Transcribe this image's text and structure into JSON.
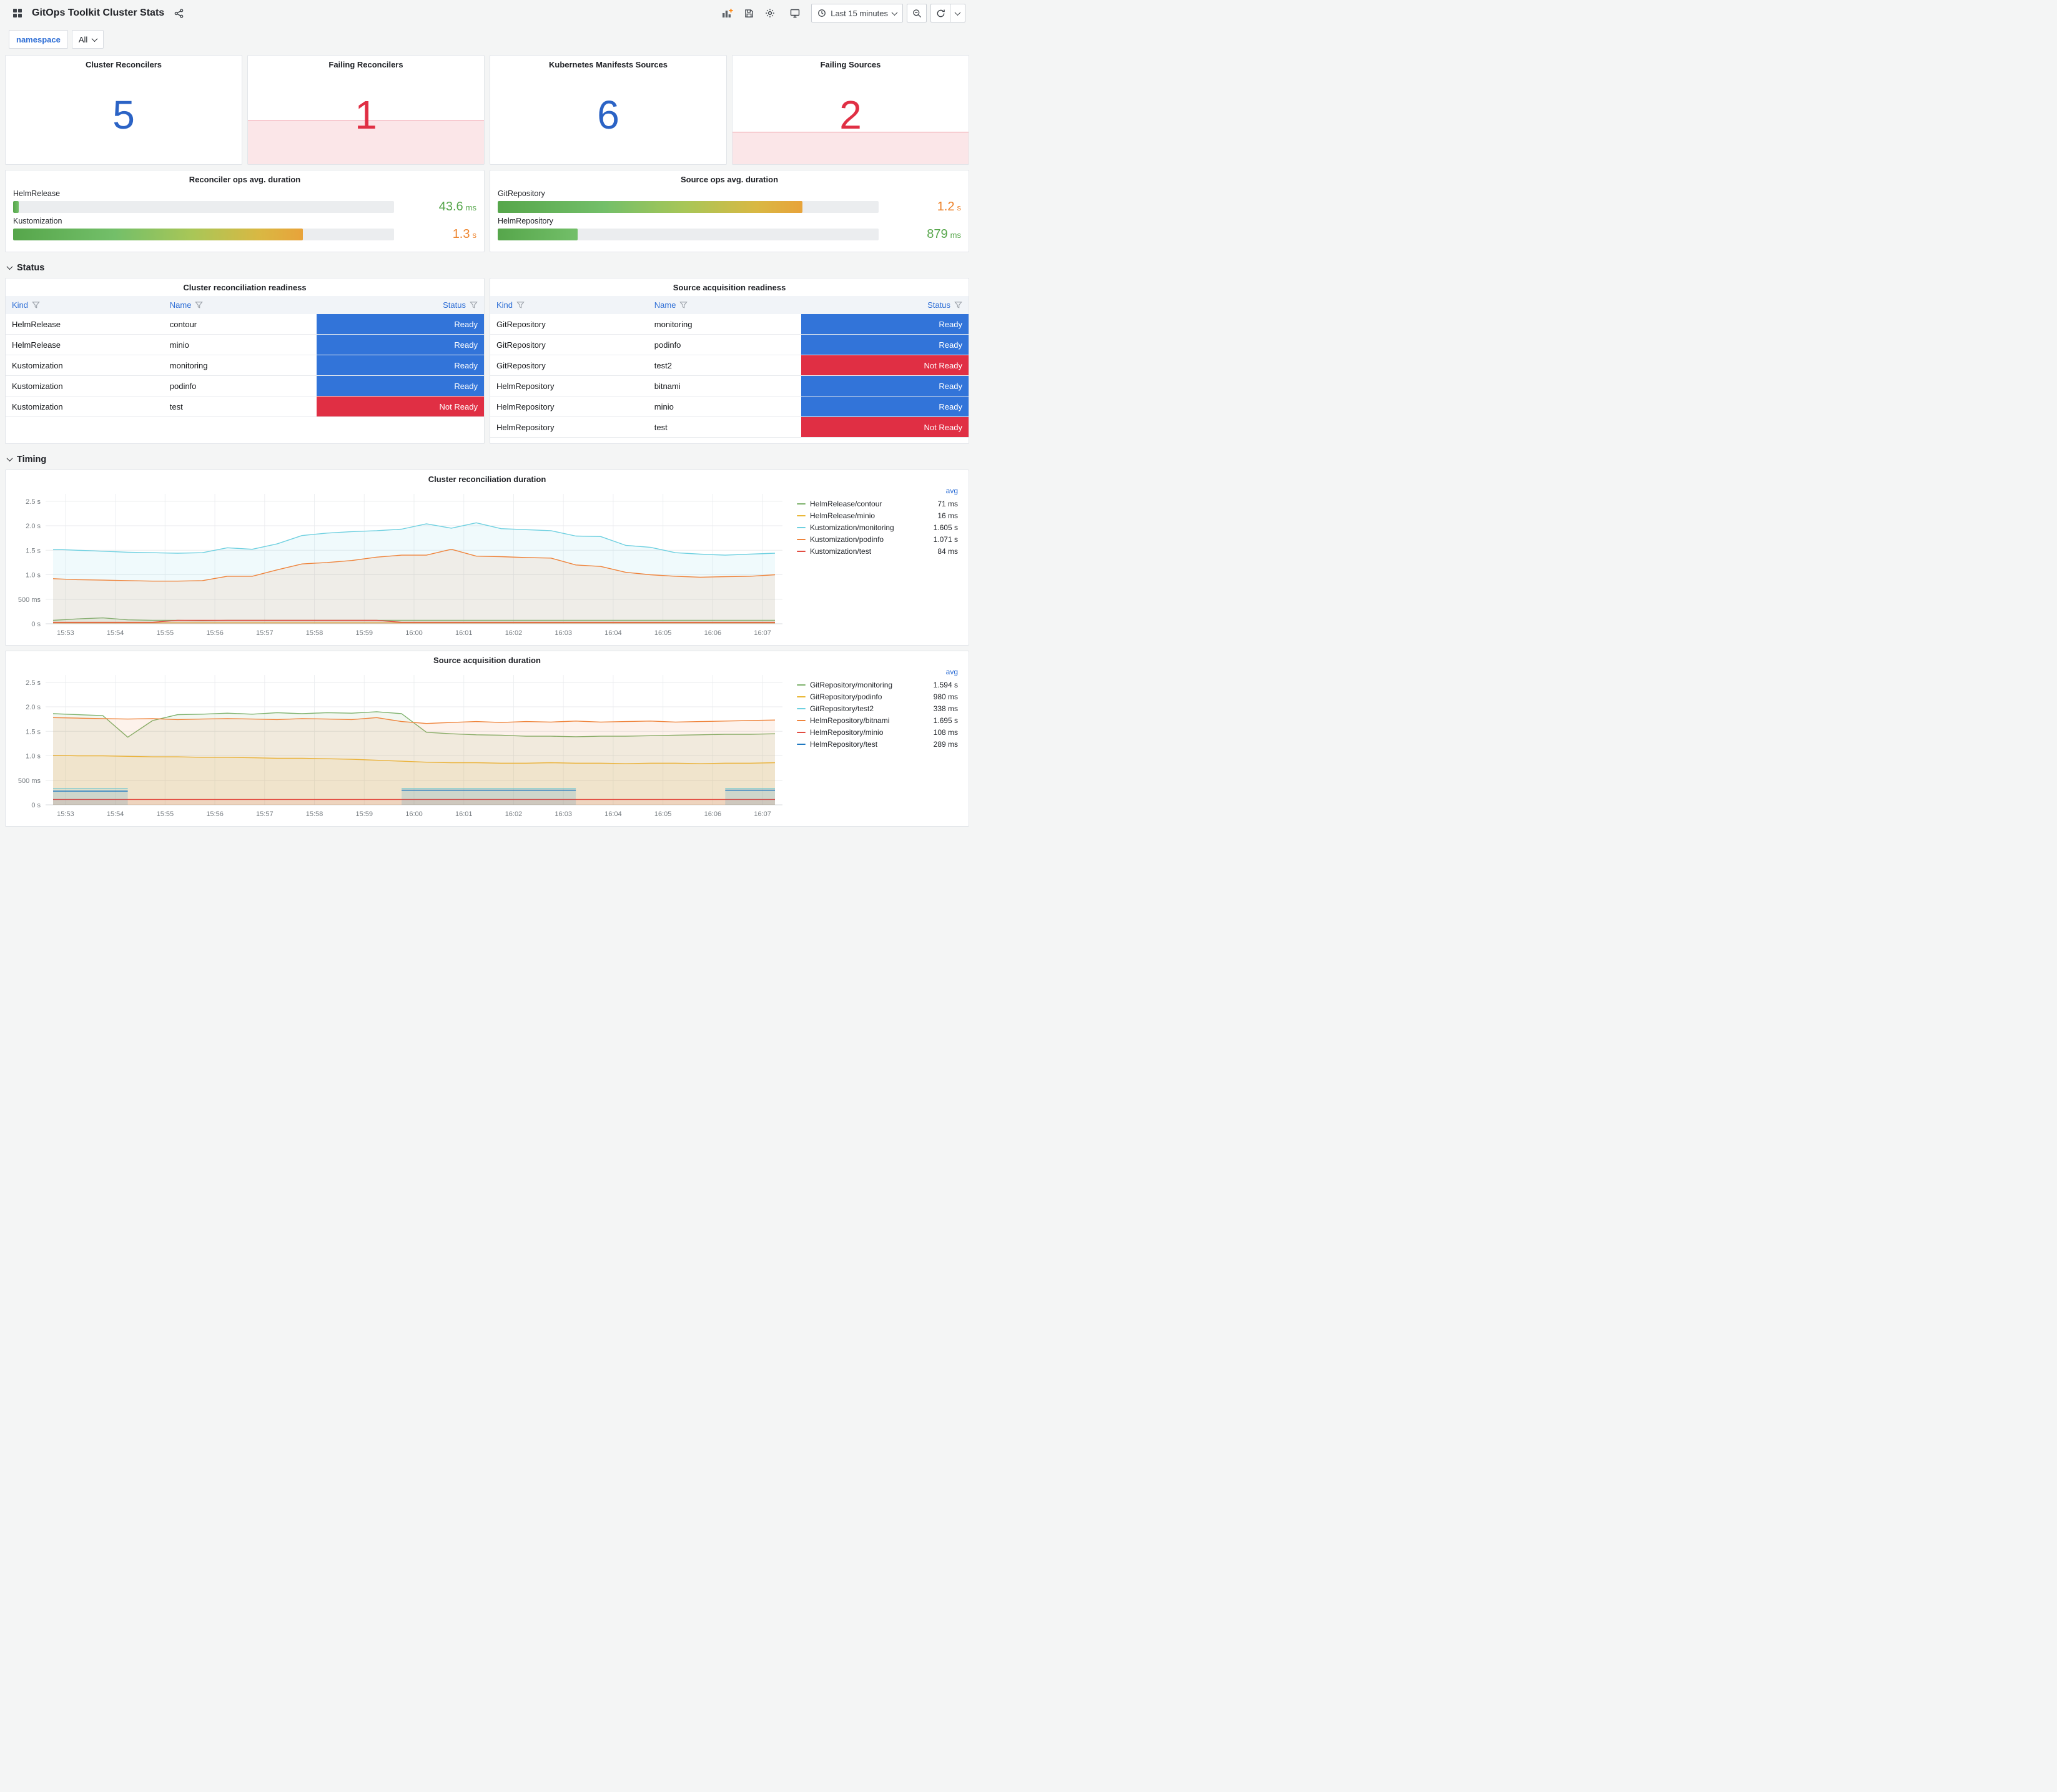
{
  "header": {
    "title": "GitOps Toolkit Cluster Stats",
    "time_range": "Last 15 minutes"
  },
  "filters": {
    "namespace_label": "namespace",
    "namespace_value": "All"
  },
  "colors": {
    "ok": "#2b63c5",
    "alert": "#e02f44",
    "ready": "#3274d9",
    "not_ready": "#e02f44",
    "green": "#56a64b",
    "orange": "#ed8128",
    "link_blue": "#2f6fd6"
  },
  "stats": [
    {
      "title": "Cluster Reconcilers",
      "value": "5",
      "state": "ok",
      "band_pct": 0
    },
    {
      "title": "Failing Reconcilers",
      "value": "1",
      "state": "alert",
      "band_pct": 40
    },
    {
      "title": "Kubernetes Manifests Sources",
      "value": "6",
      "state": "ok",
      "band_pct": 0
    },
    {
      "title": "Failing Sources",
      "value": "2",
      "state": "alert",
      "band_pct": 30
    }
  ],
  "gauge_panels": [
    {
      "title": "Reconciler ops avg. duration",
      "rows": [
        {
          "label": "HelmRelease",
          "value": "43.6",
          "unit": "ms",
          "pct": 1.5,
          "value_color": "#56a64b",
          "bar": "green"
        },
        {
          "label": "Kustomization",
          "value": "1.3",
          "unit": "s",
          "pct": 76,
          "value_color": "#ed8128",
          "bar": "mix"
        }
      ]
    },
    {
      "title": "Source ops avg. duration",
      "rows": [
        {
          "label": "GitRepository",
          "value": "1.2",
          "unit": "s",
          "pct": 80,
          "value_color": "#ed8128",
          "bar": "mix"
        },
        {
          "label": "HelmRepository",
          "value": "879",
          "unit": "ms",
          "pct": 21,
          "value_color": "#56a64b",
          "bar": "green"
        }
      ]
    }
  ],
  "sections": {
    "status": "Status",
    "timing": "Timing"
  },
  "tables": [
    {
      "title": "Cluster reconciliation readiness",
      "columns": [
        "Kind",
        "Name",
        "Status"
      ],
      "rows": [
        [
          "HelmRelease",
          "contour",
          "Ready"
        ],
        [
          "HelmRelease",
          "minio",
          "Ready"
        ],
        [
          "Kustomization",
          "monitoring",
          "Ready"
        ],
        [
          "Kustomization",
          "podinfo",
          "Ready"
        ],
        [
          "Kustomization",
          "test",
          "Not Ready"
        ]
      ]
    },
    {
      "title": "Source acquisition readiness",
      "columns": [
        "Kind",
        "Name",
        "Status"
      ],
      "rows": [
        [
          "GitRepository",
          "monitoring",
          "Ready"
        ],
        [
          "GitRepository",
          "podinfo",
          "Ready"
        ],
        [
          "GitRepository",
          "test2",
          "Not Ready"
        ],
        [
          "HelmRepository",
          "bitnami",
          "Ready"
        ],
        [
          "HelmRepository",
          "minio",
          "Ready"
        ],
        [
          "HelmRepository",
          "test",
          "Not Ready"
        ]
      ]
    }
  ],
  "chart_data": [
    {
      "type": "line",
      "title": "Cluster reconciliation duration",
      "legend_header": "avg",
      "xlim": [
        52.6,
        67.4
      ],
      "ylim": [
        0,
        2.65
      ],
      "x_start": 52.75,
      "x_step": 0.5,
      "x_tick_start": 53,
      "x_tick_labels": [
        "15:53",
        "15:54",
        "15:55",
        "15:56",
        "15:57",
        "15:58",
        "15:59",
        "16:00",
        "16:01",
        "16:02",
        "16:03",
        "16:04",
        "16:05",
        "16:06",
        "16:07"
      ],
      "y_ticks": [
        {
          "v": 0,
          "label": "0 s"
        },
        {
          "v": 0.5,
          "label": "500 ms"
        },
        {
          "v": 1,
          "label": "1.0 s"
        },
        {
          "v": 1.5,
          "label": "1.5 s"
        },
        {
          "v": 2,
          "label": "2.0 s"
        },
        {
          "v": 2.5,
          "label": "2.5 s"
        }
      ],
      "series": [
        {
          "name": "HelmRelease/contour",
          "color": "#7eb26d",
          "avg": "71 ms",
          "values": [
            0.07,
            0.1,
            0.12,
            0.08,
            0.07,
            0.07,
            0.06,
            0.07,
            0.07,
            0.07,
            0.07,
            0.07,
            0.07,
            0.07,
            0.07,
            0.07,
            0.07,
            0.07,
            0.07,
            0.07,
            0.07,
            0.07,
            0.07,
            0.07,
            0.07,
            0.07,
            0.07,
            0.07,
            0.07,
            0.07
          ]
        },
        {
          "name": "HelmRelease/minio",
          "color": "#eab839",
          "avg": "16 ms",
          "values": [
            0.02,
            0.02,
            0.02,
            0.02,
            0.02,
            0.02,
            0.02,
            0.02,
            0.02,
            0.02,
            0.02,
            0.02,
            0.02,
            0.02,
            0.02,
            0.02,
            0.02,
            0.02,
            0.02,
            0.02,
            0.02,
            0.02,
            0.02,
            0.02,
            0.02,
            0.02,
            0.02,
            0.02,
            0.02,
            0.02
          ]
        },
        {
          "name": "Kustomization/monitoring",
          "color": "#6ed0e0",
          "avg": "1.605 s",
          "values": [
            1.52,
            1.5,
            1.48,
            1.46,
            1.45,
            1.44,
            1.45,
            1.55,
            1.52,
            1.63,
            1.8,
            1.85,
            1.88,
            1.9,
            1.93,
            2.04,
            1.95,
            2.06,
            1.94,
            1.92,
            1.9,
            1.79,
            1.78,
            1.6,
            1.56,
            1.45,
            1.42,
            1.4,
            1.42,
            1.44
          ]
        },
        {
          "name": "Kustomization/podinfo",
          "color": "#ef843c",
          "avg": "1.071 s",
          "values": [
            0.92,
            0.9,
            0.89,
            0.88,
            0.87,
            0.87,
            0.88,
            0.97,
            0.97,
            1.1,
            1.22,
            1.25,
            1.29,
            1.36,
            1.4,
            1.4,
            1.52,
            1.38,
            1.37,
            1.35,
            1.34,
            1.2,
            1.17,
            1.05,
            1.0,
            0.97,
            0.95,
            0.96,
            0.97,
            1.0
          ]
        },
        {
          "name": "Kustomization/test",
          "color": "#e24d42",
          "avg": "84 ms",
          "values": [
            0.03,
            0.03,
            0.03,
            0.03,
            0.03,
            0.07,
            0.07,
            0.07,
            0.07,
            0.07,
            0.07,
            0.07,
            0.07,
            0.07,
            0.03,
            0.03,
            0.03,
            0.03,
            0.03,
            0.03,
            0.03,
            0.03,
            0.03,
            0.03,
            0.03,
            0.03,
            0.03,
            0.03,
            0.03,
            0.03
          ]
        }
      ]
    },
    {
      "type": "line",
      "title": "Source acquisition duration",
      "legend_header": "avg",
      "xlim": [
        52.6,
        67.4
      ],
      "ylim": [
        0,
        2.65
      ],
      "x_start": 52.75,
      "x_step": 0.5,
      "x_tick_start": 53,
      "x_tick_labels": [
        "15:53",
        "15:54",
        "15:55",
        "15:56",
        "15:57",
        "15:58",
        "15:59",
        "16:00",
        "16:01",
        "16:02",
        "16:03",
        "16:04",
        "16:05",
        "16:06",
        "16:07"
      ],
      "y_ticks": [
        {
          "v": 0,
          "label": "0 s"
        },
        {
          "v": 0.5,
          "label": "500 ms"
        },
        {
          "v": 1,
          "label": "1.0 s"
        },
        {
          "v": 1.5,
          "label": "1.5 s"
        },
        {
          "v": 2,
          "label": "2.0 s"
        },
        {
          "v": 2.5,
          "label": "2.5 s"
        }
      ],
      "series": [
        {
          "name": "GitRepository/monitoring",
          "color": "#7eb26d",
          "avg": "1.594 s",
          "values": [
            1.86,
            1.84,
            1.82,
            1.38,
            1.72,
            1.84,
            1.85,
            1.87,
            1.85,
            1.88,
            1.86,
            1.88,
            1.87,
            1.9,
            1.86,
            1.48,
            1.45,
            1.43,
            1.42,
            1.4,
            1.4,
            1.39,
            1.4,
            1.4,
            1.41,
            1.42,
            1.43,
            1.44,
            1.44,
            1.45
          ]
        },
        {
          "name": "GitRepository/podinfo",
          "color": "#eab839",
          "avg": "980 ms",
          "values": [
            1.01,
            1.0,
            1.0,
            0.99,
            0.98,
            0.98,
            0.97,
            0.97,
            0.96,
            0.95,
            0.95,
            0.94,
            0.93,
            0.91,
            0.89,
            0.87,
            0.86,
            0.86,
            0.85,
            0.85,
            0.86,
            0.85,
            0.85,
            0.84,
            0.85,
            0.85,
            0.84,
            0.85,
            0.85,
            0.86
          ]
        },
        {
          "name": "GitRepository/test2",
          "color": "#6ed0e0",
          "avg": "338 ms",
          "values": [
            0.33,
            0.33,
            0.33,
            0.33,
            null,
            null,
            null,
            null,
            null,
            null,
            null,
            null,
            null,
            null,
            0.33,
            0.33,
            0.33,
            0.33,
            0.33,
            0.33,
            0.33,
            0.33,
            null,
            null,
            null,
            null,
            null,
            0.33,
            0.33,
            0.33
          ]
        },
        {
          "name": "HelmRepository/bitnami",
          "color": "#ef843c",
          "avg": "1.695 s",
          "values": [
            1.78,
            1.77,
            1.76,
            1.75,
            1.76,
            1.74,
            1.75,
            1.76,
            1.75,
            1.74,
            1.76,
            1.75,
            1.74,
            1.78,
            1.7,
            1.66,
            1.68,
            1.7,
            1.68,
            1.7,
            1.69,
            1.71,
            1.69,
            1.7,
            1.71,
            1.69,
            1.7,
            1.71,
            1.72,
            1.73
          ]
        },
        {
          "name": "HelmRepository/minio",
          "color": "#e24d42",
          "avg": "108 ms",
          "values": [
            0.11,
            0.11,
            0.11,
            0.11,
            0.11,
            0.11,
            0.11,
            0.11,
            0.11,
            0.11,
            0.11,
            0.11,
            0.11,
            0.11,
            0.11,
            0.11,
            0.11,
            0.11,
            0.11,
            0.11,
            0.11,
            0.11,
            0.11,
            0.11,
            0.11,
            0.11,
            0.11,
            0.11,
            0.11,
            0.11
          ]
        },
        {
          "name": "HelmRepository/test",
          "color": "#1f78c1",
          "avg": "289 ms",
          "values": [
            0.28,
            0.28,
            0.28,
            0.28,
            null,
            null,
            null,
            null,
            null,
            null,
            null,
            null,
            null,
            null,
            0.3,
            0.3,
            0.3,
            0.3,
            0.3,
            0.3,
            0.3,
            0.3,
            null,
            null,
            null,
            null,
            null,
            0.3,
            0.3,
            0.3
          ]
        }
      ]
    }
  ]
}
